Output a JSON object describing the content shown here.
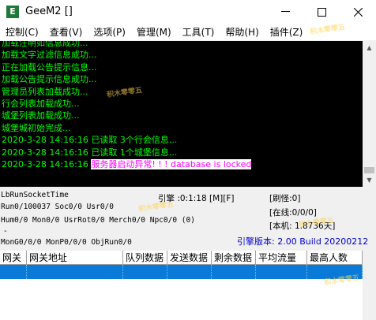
{
  "window": {
    "title": "GeeM2 []",
    "icon_letter": "E"
  },
  "menu": [
    "控制(C)",
    "查看(V)",
    "选项(P)",
    "管理(M)",
    "工具(T)",
    "帮助(H)",
    "插件(Z)"
  ],
  "log": [
    {
      "text": "加载注明如信息成功..."
    },
    {
      "text": "加载文字过滤信息成功..."
    },
    {
      "text": "正在加载公告提示信息..."
    },
    {
      "text": "加载公告提示信息成功..."
    },
    {
      "text": "管理员列表加载成功..."
    },
    {
      "text": "行会列表加载成功..."
    },
    {
      "text": "城堡列表加载成功..."
    },
    {
      "text": "城堡城初始完成..."
    },
    {
      "text": "2020-3-28 14:16:16 已读取 3个行会信息..."
    },
    {
      "text": "2020-3-28 14:16:16 已读取 1个城堡信息..."
    },
    {
      "text": "2020-3-28 14:16:16 ",
      "error": "服务器启动异常! ! ! database is locked"
    }
  ],
  "status": {
    "socket": "LbRunSocketTime",
    "engine": "引擎 :0:1:18 [M][F]",
    "refresh": "[刷怪:0]",
    "run": "Run0/100037 Soc0/0 Usr0/0",
    "online": "[在线:0/0/0]",
    "hum": "Hum0/0 Mon0/0 UsrRot0/0 Merch0/0 Npc0/0 (0)",
    "local": "[本机: 1.8736天]",
    "dash": "-",
    "mong": "MonG0/0/0 MonP0/0/0 ObjRun0/0",
    "version": "引擎版本: 2.00 Build 20200212"
  },
  "grid": {
    "columns": [
      "网关",
      "网关地址",
      "队列数据",
      "发送数据",
      "剩余数据",
      "平均流量",
      "最高人数"
    ]
  },
  "watermark": "积木零零五"
}
